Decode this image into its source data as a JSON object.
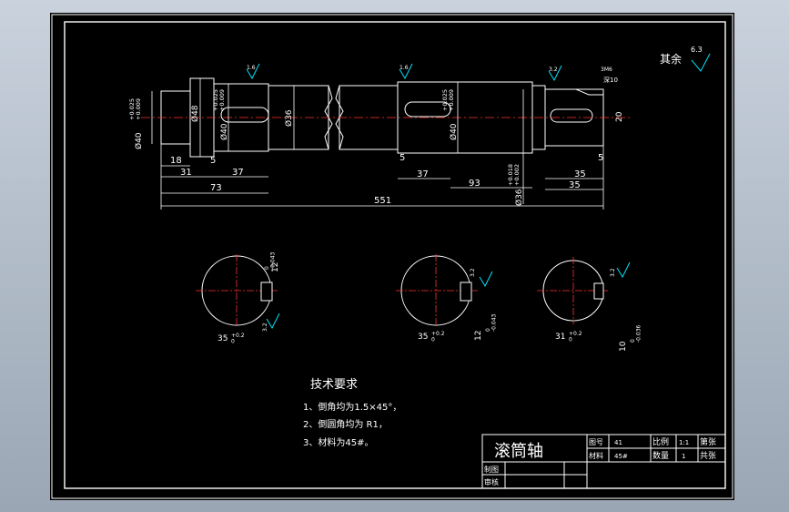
{
  "drawing": {
    "surface_roughness_default": {
      "label": "其余",
      "value": "6.3"
    },
    "shaft_dimensions": {
      "dia_40_tol": "+0.025\n+0.009",
      "dia_40": "Ø40",
      "dia_48": "Ø48",
      "dia_40_mid_tol": "+0.025\n+0.009",
      "dia_40_mid": "Ø40",
      "dia_36_main": "Ø36",
      "dia_40_right_tol": "+0.025\n+0.009",
      "dia_40_right": "Ø40",
      "dia_36_right_tol": "+0.018\n+0.002",
      "dia_36_right": "Ø36",
      "len_18": "18",
      "len_31": "31",
      "len_5a": "5",
      "len_37a": "37",
      "len_73": "73",
      "len_551": "551",
      "len_5b": "5",
      "len_37b": "37",
      "len_93": "93",
      "len_35a": "35",
      "len_35b": "35",
      "len_5c": "5",
      "len_20": "20",
      "thread_m6": "3M6",
      "hole_depth": "深10",
      "rough_1": "1.6",
      "rough_2": "1.6",
      "rough_3": "3.2"
    },
    "sections": [
      {
        "key_width": "12",
        "key_width_tol": "0\n-0.043",
        "depth": "35",
        "depth_tol": "+0.2\n0",
        "rough": "3.2"
      },
      {
        "key_width": "12",
        "key_width_tol": "0\n-0.043",
        "depth": "35",
        "depth_tol": "+0.2\n0",
        "rough": "3.2"
      },
      {
        "key_width": "10",
        "key_width_tol": "0\n-0.036",
        "depth": "31",
        "depth_tol": "+0.2\n0",
        "rough": "3.2"
      }
    ],
    "tech_requirements": {
      "title": "技术要求",
      "items": [
        "1、倒角均为1.5×45°，",
        "2、倒圆角均为 R1，",
        "3、材料为45#。"
      ]
    },
    "title_block": {
      "part_name": "滚筒轴",
      "drawing_no_label": "图号",
      "drawing_no": "41",
      "scale_label": "比例",
      "scale": "1:1",
      "sheet_label": "第张",
      "material_label": "材料",
      "material": "45#",
      "qty_label": "数量",
      "qty": "1",
      "sheets_label": "共张",
      "drawn_label": "制图",
      "checked_label": "审核"
    }
  }
}
